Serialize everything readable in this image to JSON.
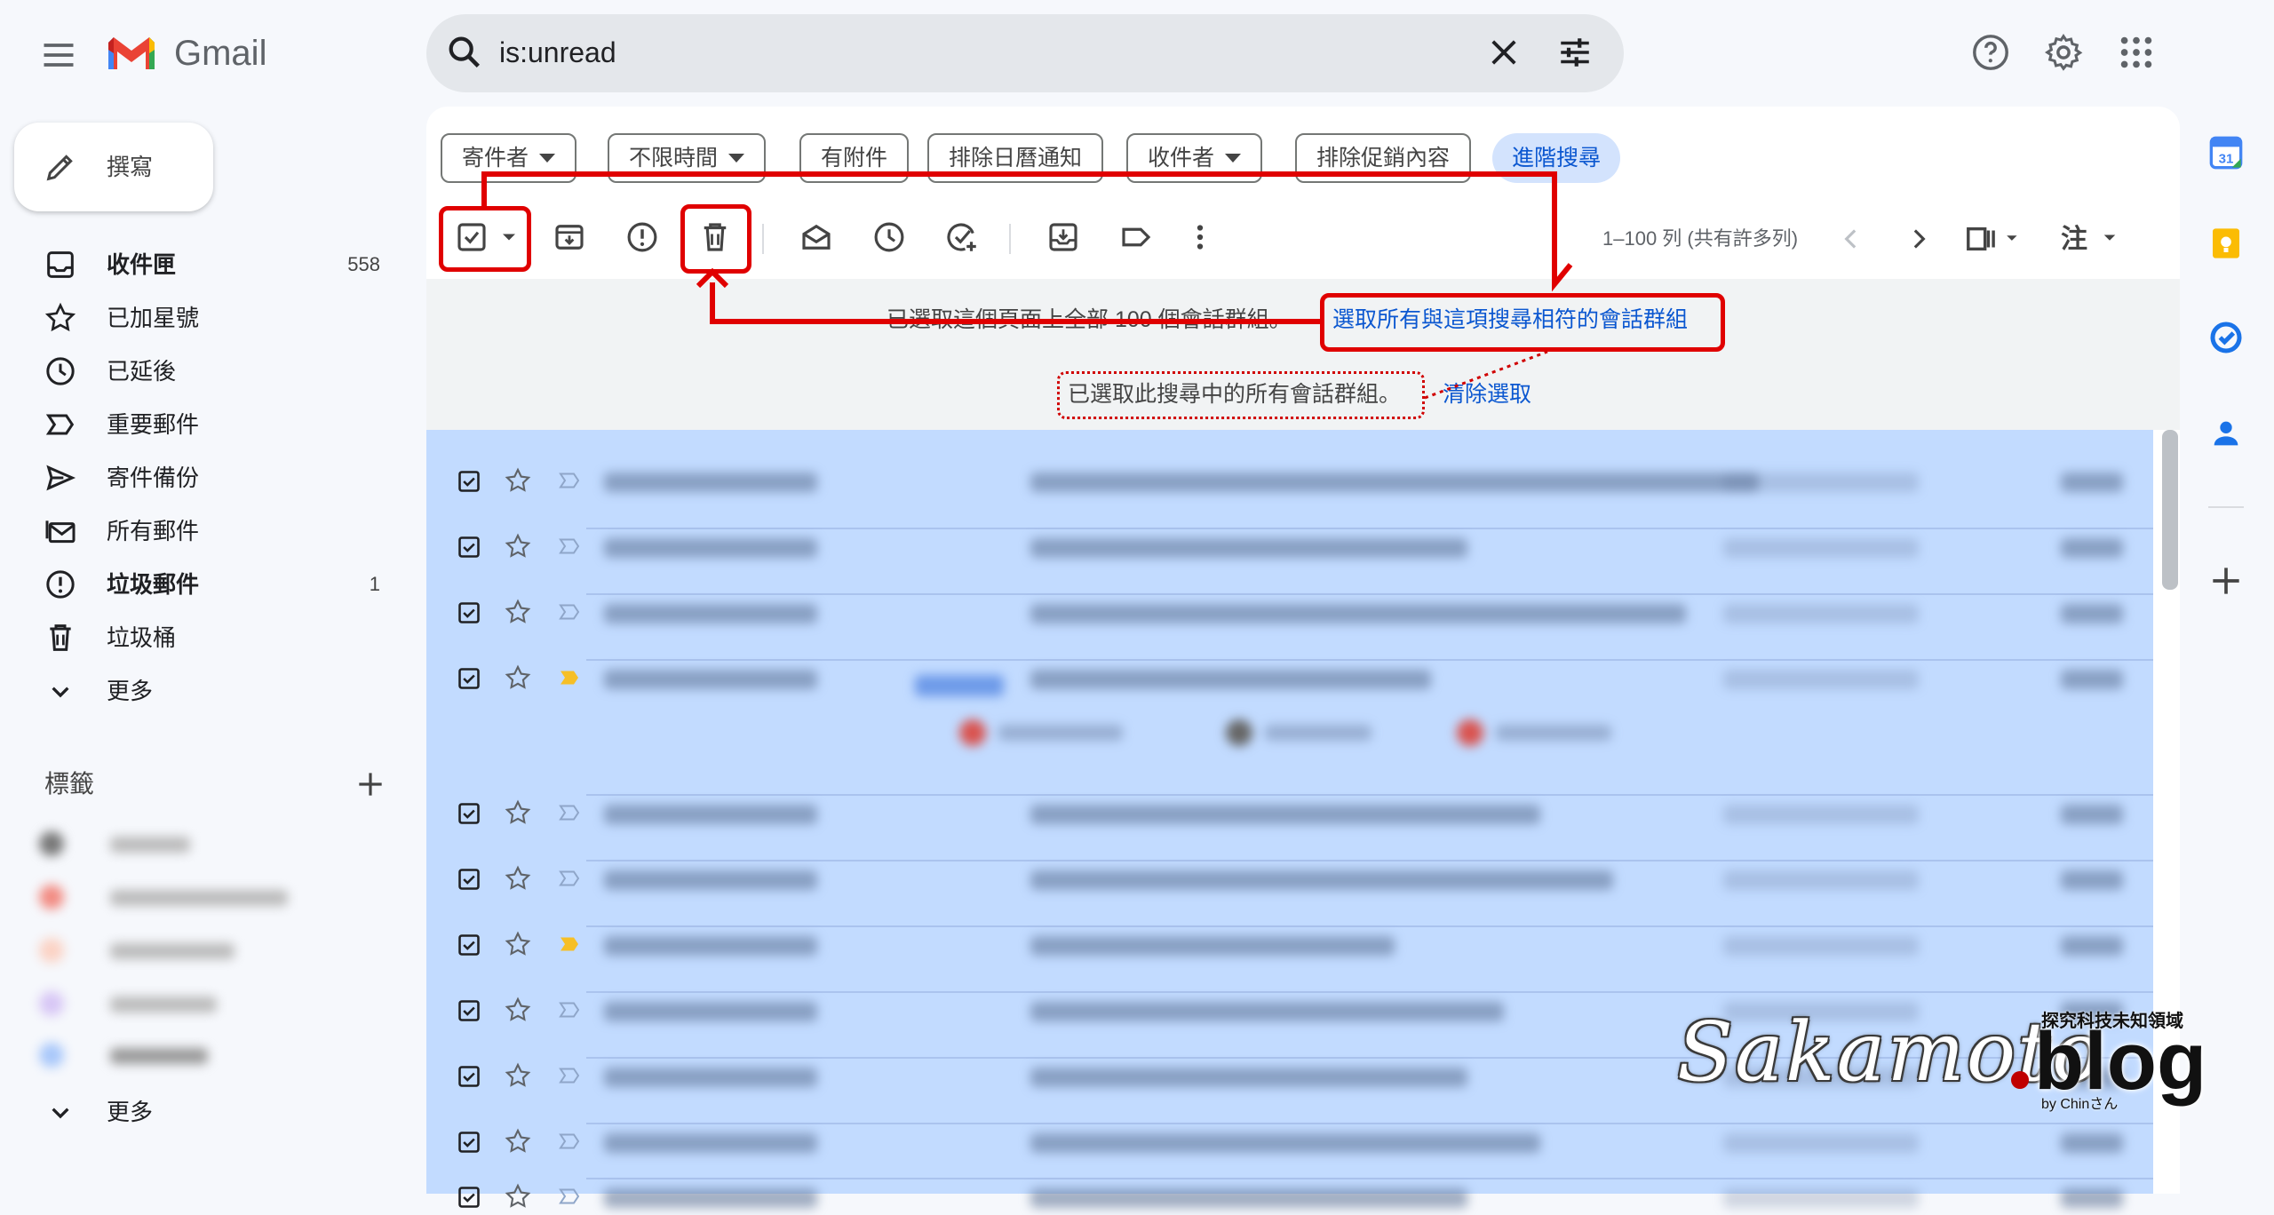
{
  "app": {
    "brand": "Gmail"
  },
  "search": {
    "query": "is:unread"
  },
  "compose": {
    "label": "撰寫"
  },
  "nav": [
    {
      "label": "收件匣",
      "count": "558",
      "bold": true
    },
    {
      "label": "已加星號",
      "count": ""
    },
    {
      "label": "已延後",
      "count": ""
    },
    {
      "label": "重要郵件",
      "count": ""
    },
    {
      "label": "寄件備份",
      "count": ""
    },
    {
      "label": "所有郵件",
      "count": ""
    },
    {
      "label": "垃圾郵件",
      "count": "1",
      "bold": true
    },
    {
      "label": "垃圾桶",
      "count": ""
    },
    {
      "label": "更多",
      "count": ""
    }
  ],
  "labels_section": {
    "title": "標籤",
    "more": "更多"
  },
  "filters": {
    "chips": [
      "寄件者",
      "不限時間",
      "有附件",
      "排除日曆通知",
      "收件者",
      "排除促銷內容"
    ],
    "advanced": "進階搜尋"
  },
  "toolbar": {
    "pager": "1–100 列 (共有許多列)",
    "input_tool": "注"
  },
  "banner": {
    "selected_page": "已選取這個頁面上全部 100 個會話群組。",
    "select_all_link": "選取所有與這項搜尋相符的會話群組",
    "selected_all": "已選取此搜尋中的所有會話群組。",
    "clear_link": "清除選取"
  },
  "watermark": {
    "script": "Sakamoto",
    "blog": "blog",
    "tagline": "探究科技未知領域",
    "by": "by Chinさん"
  },
  "colors": {
    "accent": "#0b57d0",
    "selection": "#c2dbff",
    "annotation": "#e00000"
  }
}
